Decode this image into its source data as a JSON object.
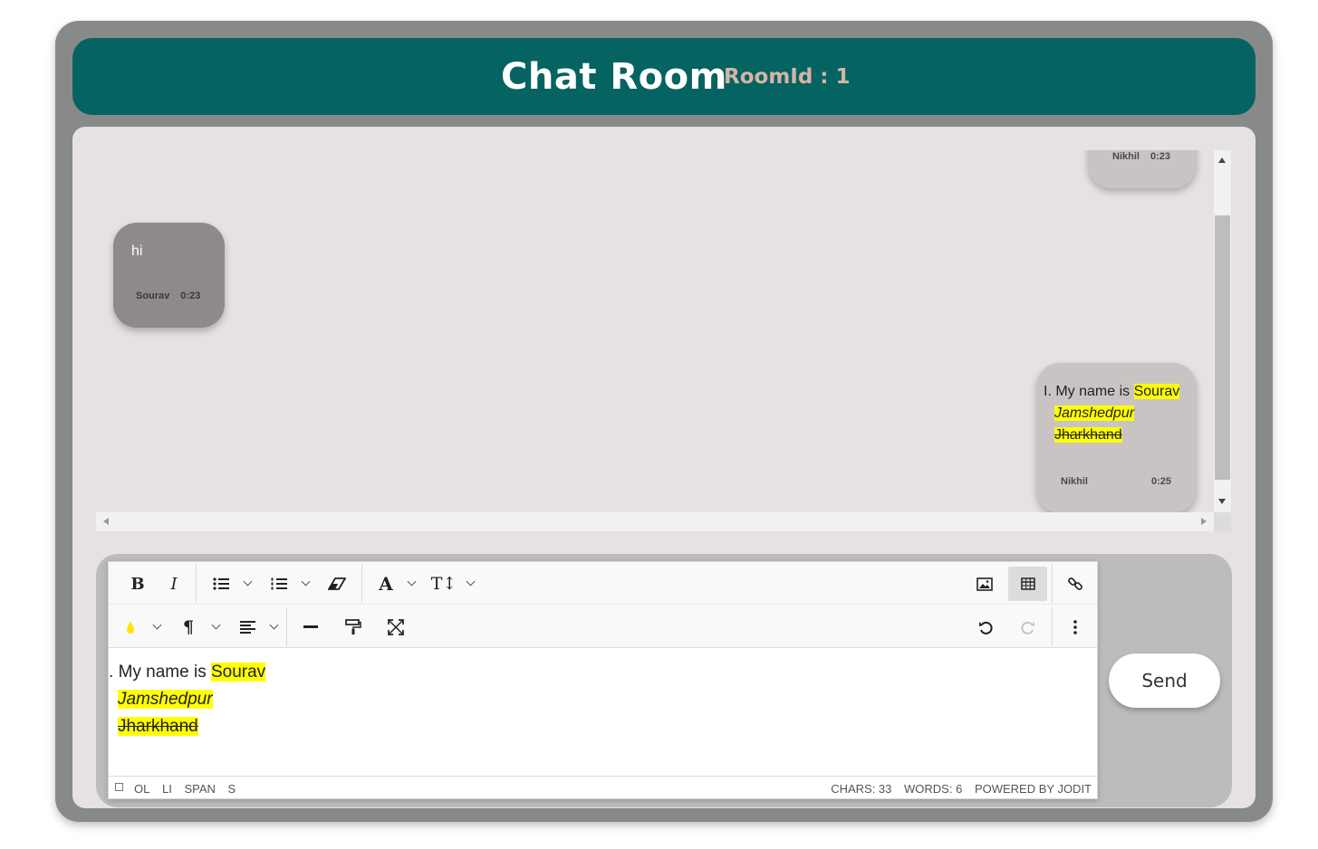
{
  "header": {
    "title": "Chat Room",
    "room_label": "RoomId : 1"
  },
  "messages": [
    {
      "user": "Nikhil",
      "time": "0:23",
      "side": "right",
      "text": ""
    },
    {
      "user": "Sourav",
      "time": "0:23",
      "side": "left",
      "text": "hi"
    },
    {
      "user": "Nikhil",
      "time": "0:25",
      "side": "right",
      "list_marker": "I.",
      "line1_plain": "My name is",
      "line1_highlight": "Sourav",
      "line2": "Jamshedpur",
      "line3": "Jharkhand"
    }
  ],
  "editor": {
    "content": {
      "list_marker": ".",
      "line1_plain": "My name is",
      "line1_highlight": "Sourav",
      "line2": "Jamshedpur",
      "line3": "Jharkhand"
    },
    "status_path": [
      "OL",
      "LI",
      "SPAN",
      "S"
    ],
    "chars": "CHARS: 33",
    "words": "WORDS: 6",
    "powered": "POWERED BY JODIT",
    "toolbar_row1": [
      "bold-icon",
      "italic-icon",
      "bulleted-list-icon",
      "numbered-list-icon",
      "eraser-icon",
      "font-icon",
      "font-size-icon",
      "image-icon",
      "table-icon",
      "link-icon"
    ],
    "toolbar_row2": [
      "brush-icon",
      "paragraph-icon",
      "align-icon",
      "horizontal-rule-icon",
      "copy-format-icon",
      "fullscreen-icon",
      "undo-icon",
      "redo-icon",
      "more-icon"
    ]
  },
  "send_label": "Send",
  "colors": {
    "header": "#056361",
    "frame": "#888a89",
    "highlight": "#ffff00",
    "room_label": "#d6b4a8"
  }
}
